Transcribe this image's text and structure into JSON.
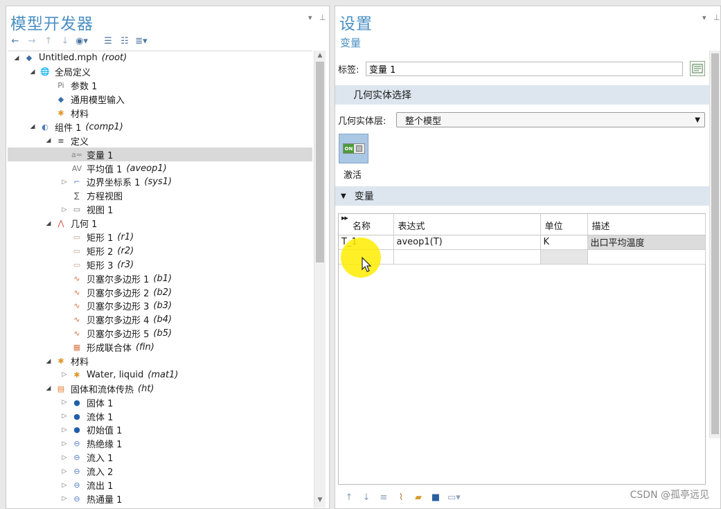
{
  "left": {
    "title": "模型开发器",
    "toolbar": [
      "back-arrow-icon",
      "forward-arrow-icon",
      "up-arrow-icon",
      "down-arrow-icon",
      "view-icon",
      "expand-icon",
      "collapse-icon",
      "list-icon"
    ],
    "tree": [
      {
        "level": 0,
        "twist": "open",
        "icon": "root",
        "label": "Untitled.mph",
        "tag": "(root)"
      },
      {
        "level": 1,
        "twist": "open",
        "icon": "globe",
        "label": "全局定义",
        "tag": ""
      },
      {
        "level": 2,
        "twist": "",
        "icon": "pi",
        "label": "参数 1",
        "tag": ""
      },
      {
        "level": 2,
        "twist": "",
        "icon": "diamond",
        "label": "通用模型输入",
        "tag": ""
      },
      {
        "level": 2,
        "twist": "",
        "icon": "material",
        "label": "材料",
        "tag": ""
      },
      {
        "level": 1,
        "twist": "open",
        "icon": "component",
        "label": "组件 1",
        "tag": "(comp1)"
      },
      {
        "level": 2,
        "twist": "open",
        "icon": "defs",
        "label": "定义",
        "tag": ""
      },
      {
        "level": 3,
        "twist": "",
        "icon": "var",
        "label": "变量 1",
        "tag": "",
        "selected": true
      },
      {
        "level": 3,
        "twist": "",
        "icon": "av",
        "label": "平均值 1",
        "tag": "(aveop1)"
      },
      {
        "level": 3,
        "twist": "closed",
        "icon": "coord",
        "label": "边界坐标系 1",
        "tag": "(sys1)"
      },
      {
        "level": 3,
        "twist": "",
        "icon": "eq",
        "label": "方程视图",
        "tag": ""
      },
      {
        "level": 3,
        "twist": "closed",
        "icon": "view",
        "label": "视图 1",
        "tag": ""
      },
      {
        "level": 2,
        "twist": "open",
        "icon": "geom",
        "label": "几何 1",
        "tag": ""
      },
      {
        "level": 3,
        "twist": "",
        "icon": "rect",
        "label": "矩形 1",
        "tag": "(r1)"
      },
      {
        "level": 3,
        "twist": "",
        "icon": "rect",
        "label": "矩形 2",
        "tag": "(r2)"
      },
      {
        "level": 3,
        "twist": "",
        "icon": "rect",
        "label": "矩形 3",
        "tag": "(r3)"
      },
      {
        "level": 3,
        "twist": "",
        "icon": "bezier",
        "label": "贝塞尔多边形 1",
        "tag": "(b1)"
      },
      {
        "level": 3,
        "twist": "",
        "icon": "bezier",
        "label": "贝塞尔多边形 2",
        "tag": "(b2)"
      },
      {
        "level": 3,
        "twist": "",
        "icon": "bezier",
        "label": "贝塞尔多边形 3",
        "tag": "(b3)"
      },
      {
        "level": 3,
        "twist": "",
        "icon": "bezier",
        "label": "贝塞尔多边形 4",
        "tag": "(b4)"
      },
      {
        "level": 3,
        "twist": "",
        "icon": "bezier",
        "label": "贝塞尔多边形 5",
        "tag": "(b5)"
      },
      {
        "level": 3,
        "twist": "",
        "icon": "union",
        "label": "形成联合体",
        "tag": "(fin)"
      },
      {
        "level": 2,
        "twist": "open",
        "icon": "material",
        "label": "材料",
        "tag": ""
      },
      {
        "level": 3,
        "twist": "closed",
        "icon": "material",
        "label": "Water, liquid",
        "tag": "(mat1)"
      },
      {
        "level": 2,
        "twist": "open",
        "icon": "heat",
        "label": "固体和流体传热",
        "tag": "(ht)"
      },
      {
        "level": 3,
        "twist": "closed",
        "icon": "domain",
        "label": "固体 1",
        "tag": ""
      },
      {
        "level": 3,
        "twist": "closed",
        "icon": "domain",
        "label": "流体 1",
        "tag": ""
      },
      {
        "level": 3,
        "twist": "closed",
        "icon": "domain",
        "label": "初始值 1",
        "tag": ""
      },
      {
        "level": 3,
        "twist": "closed",
        "icon": "boundary",
        "label": "热绝缘 1",
        "tag": ""
      },
      {
        "level": 3,
        "twist": "closed",
        "icon": "boundary",
        "label": "流入 1",
        "tag": ""
      },
      {
        "level": 3,
        "twist": "closed",
        "icon": "boundary",
        "label": "流入 2",
        "tag": ""
      },
      {
        "level": 3,
        "twist": "closed",
        "icon": "boundary",
        "label": "流出 1",
        "tag": ""
      },
      {
        "level": 3,
        "twist": "closed",
        "icon": "boundary",
        "label": "热通量 1",
        "tag": ""
      }
    ]
  },
  "right": {
    "title": "设置",
    "subtitle": "变量",
    "label_caption": "标签:",
    "label_value": "变量 1",
    "geo_section": "几何实体选择",
    "geo_level_caption": "几何实体层:",
    "geo_level_value": "整个模型",
    "activate_caption": "激活",
    "toggle_text": "ON",
    "var_section": "变量",
    "table": {
      "headers": [
        "名称",
        "表达式",
        "单位",
        "描述"
      ],
      "rows": [
        [
          "T_1",
          "aveop1(T)",
          "K",
          "出口平均温度"
        ],
        [
          "",
          "",
          "",
          ""
        ]
      ]
    }
  },
  "watermark": "CSDN @孤亭远见",
  "colors": {
    "title_blue": "#4a8fc2",
    "section_bg": "#dde6ef",
    "selected_row": "#d9d9d9",
    "cursor_highlight": "#ffec00"
  }
}
